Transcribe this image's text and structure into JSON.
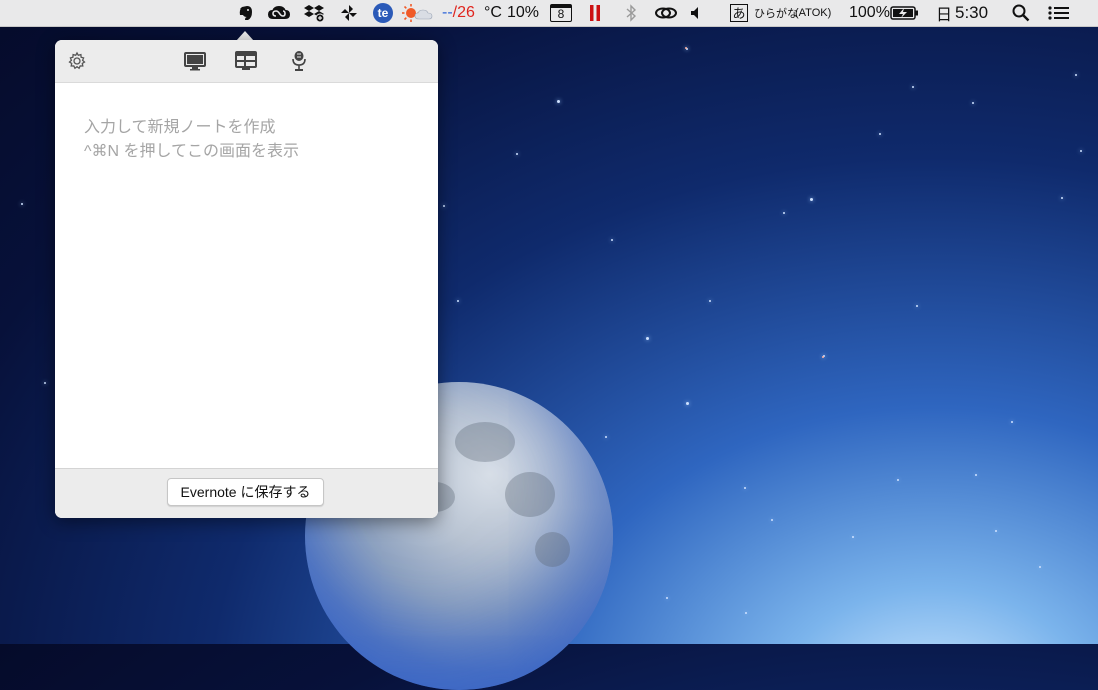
{
  "menubar": {
    "icons": [
      "evernote-elephant-icon",
      "creative-cloud-icon",
      "dropbox-icon",
      "pinwheel-icon",
      "te-circle-icon",
      "sun-cloud-weather-icon",
      "calendar-icon",
      "pause-icon",
      "bluetooth-icon",
      "link-icon",
      "volume-icon",
      "atok-a-icon",
      "battery-charging-icon",
      "spotlight-search-icon",
      "notification-list-icon"
    ],
    "weather_dash": "--",
    "weather_temp": "/26",
    "weather_unit": "°C",
    "humidity": "10%",
    "calendar_day": "8",
    "atok_char": "あ",
    "input_mode": "ひらがな",
    "input_method": "(ATOK)",
    "battery": "100%",
    "day": "日",
    "time": "5:30"
  },
  "popover": {
    "toolbar_icons": [
      "gear-icon",
      "desktop-capture-icon",
      "window-capture-icon",
      "microphone-icon"
    ],
    "placeholder_line1": "入力して新規ノートを作成",
    "placeholder_line2": "^⌘N を押してこの画面を表示",
    "save_button": "Evernote に保存する"
  },
  "colors": {
    "weather_red": "#e0261f",
    "weather_blue": "#2a62d8",
    "pause_red": "#cc1111",
    "te_blue": "#2b5ab8"
  }
}
